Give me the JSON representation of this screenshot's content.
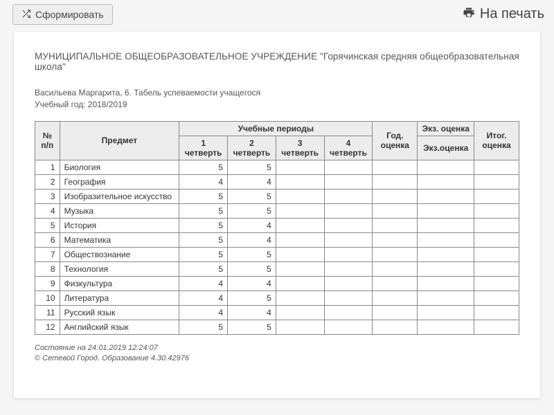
{
  "toolbar": {
    "generate_label": "Сформировать",
    "print_label": "На печать"
  },
  "header": {
    "org_prefix": "МУНИЦИПАЛЬНОЕ ОБЩЕОБРАЗОВАТЕЛЬНОЕ УЧРЕЖДЕНИЕ",
    "school_name": "\"Горячинская средняя общеобразовательная школа\"",
    "student_line": "Васильева Маргарита, 6. Табель успеваемости учащегося",
    "year_line": "Учебный год: 2018/2019"
  },
  "table": {
    "col_num": "№ п/п",
    "col_subject": "Предмет",
    "col_periods": "Учебные периоды",
    "col_year": "Год. оценка",
    "col_exam_group": "Экз. оценка",
    "col_final": "Итог. оценка",
    "col_q1": "1 четверть",
    "col_q2": "2 четверть",
    "col_q3": "3 четверть",
    "col_q4": "4 четверть",
    "col_exam": "Экз.оценка",
    "rows": [
      {
        "n": "1",
        "subject": "Биология",
        "q1": "5",
        "q2": "5",
        "q3": "",
        "q4": "",
        "year": "",
        "exam": "",
        "final": ""
      },
      {
        "n": "2",
        "subject": "География",
        "q1": "4",
        "q2": "4",
        "q3": "",
        "q4": "",
        "year": "",
        "exam": "",
        "final": ""
      },
      {
        "n": "3",
        "subject": "Изобразительное искусство",
        "q1": "5",
        "q2": "5",
        "q3": "",
        "q4": "",
        "year": "",
        "exam": "",
        "final": ""
      },
      {
        "n": "4",
        "subject": "Музыка",
        "q1": "5",
        "q2": "5",
        "q3": "",
        "q4": "",
        "year": "",
        "exam": "",
        "final": ""
      },
      {
        "n": "5",
        "subject": "История",
        "q1": "5",
        "q2": "4",
        "q3": "",
        "q4": "",
        "year": "",
        "exam": "",
        "final": ""
      },
      {
        "n": "6",
        "subject": "Математика",
        "q1": "5",
        "q2": "4",
        "q3": "",
        "q4": "",
        "year": "",
        "exam": "",
        "final": ""
      },
      {
        "n": "7",
        "subject": "Обществознание",
        "q1": "5",
        "q2": "5",
        "q3": "",
        "q4": "",
        "year": "",
        "exam": "",
        "final": ""
      },
      {
        "n": "8",
        "subject": "Технология",
        "q1": "5",
        "q2": "5",
        "q3": "",
        "q4": "",
        "year": "",
        "exam": "",
        "final": ""
      },
      {
        "n": "9",
        "subject": "Физкультура",
        "q1": "4",
        "q2": "4",
        "q3": "",
        "q4": "",
        "year": "",
        "exam": "",
        "final": ""
      },
      {
        "n": "10",
        "subject": "Литература",
        "q1": "4",
        "q2": "5",
        "q3": "",
        "q4": "",
        "year": "",
        "exam": "",
        "final": ""
      },
      {
        "n": "11",
        "subject": "Русский язык",
        "q1": "4",
        "q2": "4",
        "q3": "",
        "q4": "",
        "year": "",
        "exam": "",
        "final": ""
      },
      {
        "n": "12",
        "subject": "Английский язык",
        "q1": "5",
        "q2": "5",
        "q3": "",
        "q4": "",
        "year": "",
        "exam": "",
        "final": ""
      }
    ]
  },
  "footer": {
    "status_line": "Состояние на 24.01.2019 12:24:07",
    "copyright_line": "© Сетевой Город. Образование 4.30.42976"
  }
}
